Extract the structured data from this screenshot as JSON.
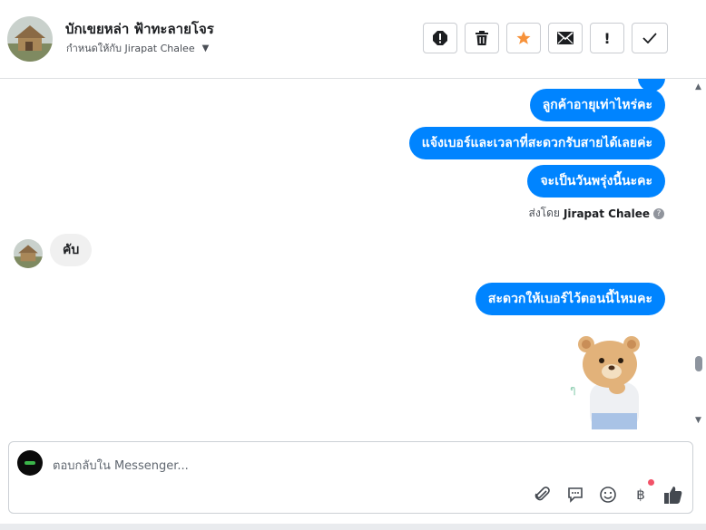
{
  "header": {
    "contact_name": "บักเขยหล่า ฟ้าทะลายโจร",
    "assigned_label": "กำหนดให้กับ Jirapat Chalee",
    "toolbar_icons": [
      "spam-icon",
      "trash-icon",
      "star-icon",
      "mail-icon",
      "exclamation-icon",
      "check-icon"
    ]
  },
  "conversation": {
    "messages": [
      {
        "from": "page",
        "text": "ลูกค้าอายุเท่าไหร่คะ"
      },
      {
        "from": "page",
        "text": "แจ้งเบอร์และเวลาที่สะดวกรับสายได้เลยค่ะ"
      },
      {
        "from": "page",
        "text": "จะเป็นวันพรุ่งนี้นะคะ"
      },
      {
        "from": "customer",
        "text": "คับ"
      },
      {
        "from": "page",
        "text": "สะดวกให้เบอร์ไว้ตอนนี้ไหมคะ"
      }
    ],
    "sent_by_prefix": "ส่งโดย",
    "sent_by_name": "Jirapat Chalee",
    "sticker": "bear-sticker"
  },
  "composer": {
    "placeholder": "ตอบกลับใน Messenger...",
    "tools": [
      "attachment-icon",
      "saved-replies-icon",
      "emoji-icon",
      "payment-icon",
      "like-icon"
    ],
    "payment_symbol": "฿"
  },
  "colors": {
    "accent": "#0084ff",
    "incoming_bubble": "#f0f0f0",
    "star": "#f7923a",
    "notification_dot": "#f25268"
  }
}
